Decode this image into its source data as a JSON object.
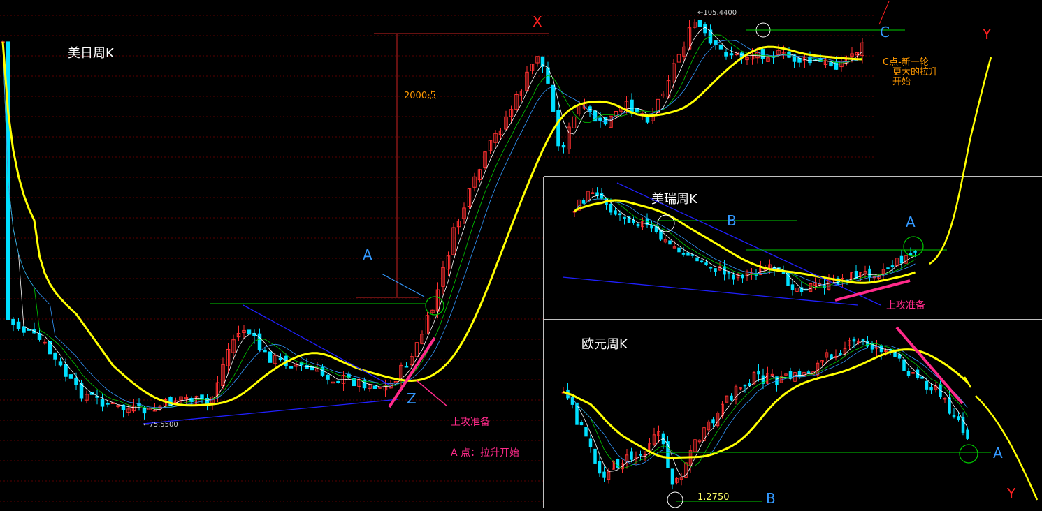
{
  "chart_data": [
    {
      "type": "candlestick",
      "title": "美日周K",
      "annotations": {
        "high_price": "105.4400",
        "low_price": "75.5500",
        "points_label": "2000点",
        "label_x": "X",
        "label_a": "A",
        "label_z": "Z",
        "label_c": "C",
        "label_y": "Y",
        "attack_prep": "上攻准备",
        "a_point_note": "A 点：拉升开始",
        "c_note_line1": "C点-新一轮",
        "c_note_line2": "更大的拉升",
        "c_note_line3": "开始"
      }
    },
    {
      "type": "candlestick",
      "title": "美瑞周K",
      "annotations": {
        "label_b": "B",
        "label_a": "A",
        "attack_prep": "上攻准备"
      }
    },
    {
      "type": "candlestick",
      "title": "欧元周K",
      "annotations": {
        "low_price": "1.2750",
        "label_b": "B",
        "label_a": "A",
        "label_y": "Y"
      }
    }
  ],
  "colors": {
    "background": "#000000",
    "up_candle": "#ff3030",
    "down_candle": "#00e0ff",
    "ma_long": "#ffff00",
    "trend_line": "#2020ff",
    "support_line": "#00cc00",
    "highlight": "#ff2a8a",
    "label_blue": "#3399ff",
    "label_red": "#ff2020",
    "note_orange": "#ff9900",
    "text_white": "#ffffff"
  }
}
